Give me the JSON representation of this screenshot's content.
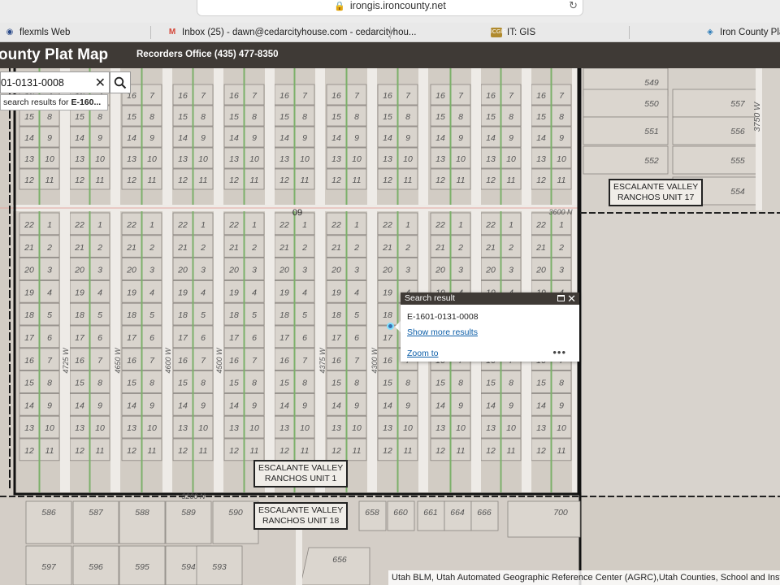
{
  "browser": {
    "url": "irongis.ironcounty.net",
    "bookmarks": [
      {
        "label": "flexmls Web",
        "icon": "flexmls-icon"
      },
      {
        "label": "Inbox (25) - dawn@cedarcityhouse.com - cedarcityhou...",
        "icon": "gmail-icon"
      },
      {
        "label": "IT: GIS",
        "icon": "gis-icon"
      },
      {
        "label": "Iron County Plat M",
        "icon": "plat-map-icon"
      }
    ]
  },
  "app": {
    "title": "ounty Plat Map",
    "subtitle": "Recorders Office (435) 477-8350"
  },
  "search": {
    "value": "01-0131-0008",
    "suggestion_prefix": "search results for ",
    "suggestion_term": "E-160..."
  },
  "popup": {
    "title": "Search result",
    "value": "E-1601-0131-0008",
    "show_more": "Show more results",
    "zoom_to": "Zoom to",
    "menu": "•••"
  },
  "map": {
    "plat_labels": [
      {
        "line1": "ESCALANTE VALLEY",
        "line2": "RANCHOS UNIT 17"
      },
      {
        "line1": "ESCALANTE VALLEY",
        "line2": "RANCHOS UNIT 1"
      },
      {
        "line1": "ESCALANTE VALLEY",
        "line2": "RANCHOS UNIT 18"
      }
    ],
    "section_labels": [
      "09",
      "16"
    ],
    "road_labels": [
      "3600 N",
      "3200 N",
      "3750 W",
      "4725 W",
      "4650 W",
      "4600 W",
      "4500 W",
      "4375 W",
      "4300 W"
    ],
    "col_lots": [
      [
        "16",
        "7",
        "15",
        "8",
        "14",
        "9",
        "13",
        "10",
        "12",
        "11"
      ],
      [
        "22",
        "1",
        "21",
        "2",
        "20",
        "3",
        "19",
        "4",
        "18",
        "5",
        "17",
        "6",
        "16",
        "7",
        "15",
        "8",
        "14",
        "9",
        "13",
        "10",
        "12",
        "11"
      ]
    ],
    "east_lots": [
      "549",
      "550",
      "557",
      "551",
      "556",
      "552",
      "555",
      "554"
    ],
    "south_lots": [
      "586",
      "587",
      "588",
      "589",
      "590",
      "658",
      "660",
      "661",
      "664",
      "666",
      "700",
      "597",
      "596",
      "595",
      "594",
      "593",
      "656"
    ]
  },
  "attribution": "Utah BLM, Utah Automated Geographic Reference Center (AGRC),Utah Counties, School and Institu"
}
